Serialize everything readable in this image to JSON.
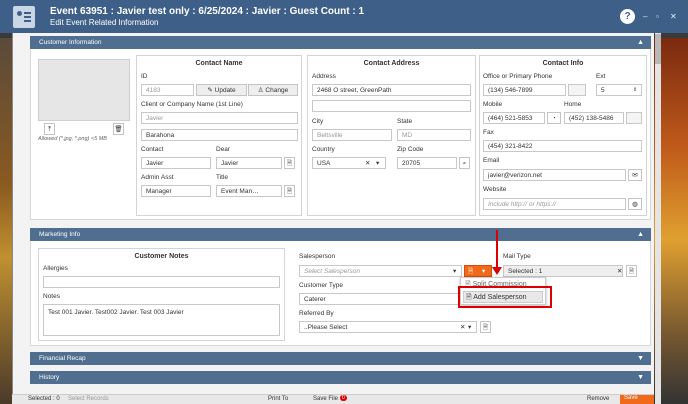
{
  "window": {
    "title": "Event 63951 : Javier test only : 6/25/2024 : Javier : Guest Count : 1",
    "subtitle": "Edit Event Related Information",
    "help_label": "?",
    "minimize": "–",
    "maximize": "▫",
    "close": "✕"
  },
  "customer_info": {
    "header": "Customer Information",
    "photo_note": "Allowed (*.jpg, *.png) <5 MB",
    "contact_name": {
      "title": "Contact Name",
      "id_label": "ID",
      "id_value": "4183",
      "update_label": "Update",
      "change_label": "Change",
      "client_label": "Client or Company Name (1st Line)",
      "client_line1": "Javier",
      "client_line2": "Barahona",
      "contact_label": "Contact",
      "contact_value": "Javier",
      "dear_label": "Dear",
      "dear_value": "Javier",
      "admin_label": "Admin Asst",
      "admin_value": "Manager",
      "title_label": "Title",
      "title_value": "Event Man…"
    },
    "contact_address": {
      "title": "Contact Address",
      "address_label": "Address",
      "address_value": "2468 O street, GreenPath",
      "city_label": "City",
      "city_value": "Beltsville",
      "state_label": "State",
      "state_value": "MD",
      "country_label": "Country",
      "country_value": "USA",
      "zip_label": "Zip Code",
      "zip_value": "20705"
    },
    "contact_info": {
      "title": "Contact Info",
      "phone_label": "Office or Primary Phone",
      "phone_value": "(134) 546-7899",
      "ext_label": "Ext",
      "ext_value": "5",
      "mobile_label": "Mobile",
      "mobile_value": "(464) 521-5853",
      "home_label": "Home",
      "home_value": "(452) 138-5486",
      "fax_label": "Fax",
      "fax_value": "(454) 321-8422",
      "email_label": "Email",
      "email_value": "javier@verizon.net",
      "website_label": "Website",
      "website_placeholder": "Include http:// or https://"
    }
  },
  "marketing": {
    "header": "Marketing Info",
    "notes_title": "Customer Notes",
    "allergies_label": "Allergies",
    "notes_label": "Notes",
    "notes_value": "Test 001 Javier. Test002 Javier. Test 003 Javier",
    "salesperson_label": "Salesperson",
    "salesperson_placeholder": "Select Salesperson",
    "mail_type_label": "Mail Type",
    "mail_type_value": "Selected : 1",
    "customer_type_label": "Customer Type",
    "customer_type_value": "Caterer",
    "referred_label": "Referred By",
    "referred_value": "..Please Select",
    "dropdown_items": [
      "Split Commission",
      "Add Salesperson"
    ]
  },
  "sections": {
    "financial": "Financial Recap",
    "history": "History"
  },
  "footer": {
    "selected": "Selected : 0",
    "select_records": "Select Records",
    "print": "Print To",
    "save_file": "Save File",
    "save_file_badge": "0",
    "remove": "Remove",
    "save": "Save"
  }
}
